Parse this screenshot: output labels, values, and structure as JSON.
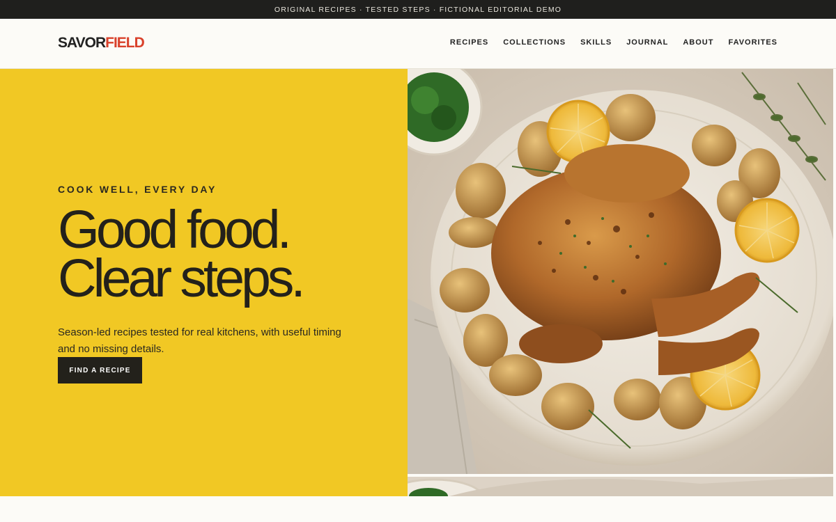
{
  "topbar": {
    "text": "ORIGINAL RECIPES · TESTED STEPS · FICTIONAL EDITORIAL DEMO"
  },
  "header": {
    "logo_primary": "SAVOR",
    "logo_accent": "FIELD",
    "nav": [
      "RECIPES",
      "COLLECTIONS",
      "SKILLS",
      "JOURNAL",
      "ABOUT",
      "FAVORITES"
    ]
  },
  "hero": {
    "eyebrow": "COOK WELL, EVERY DAY",
    "headline_line1": "Good food.",
    "headline_line2": "Clear steps.",
    "subcopy": "Season-led recipes tested for real kitchens, with useful timing and no missing details.",
    "cta_label": "FIND A RECIPE"
  },
  "colors": {
    "brand_accent": "#d9412b",
    "hero_yellow": "#f1c824",
    "dark": "#23211b"
  }
}
